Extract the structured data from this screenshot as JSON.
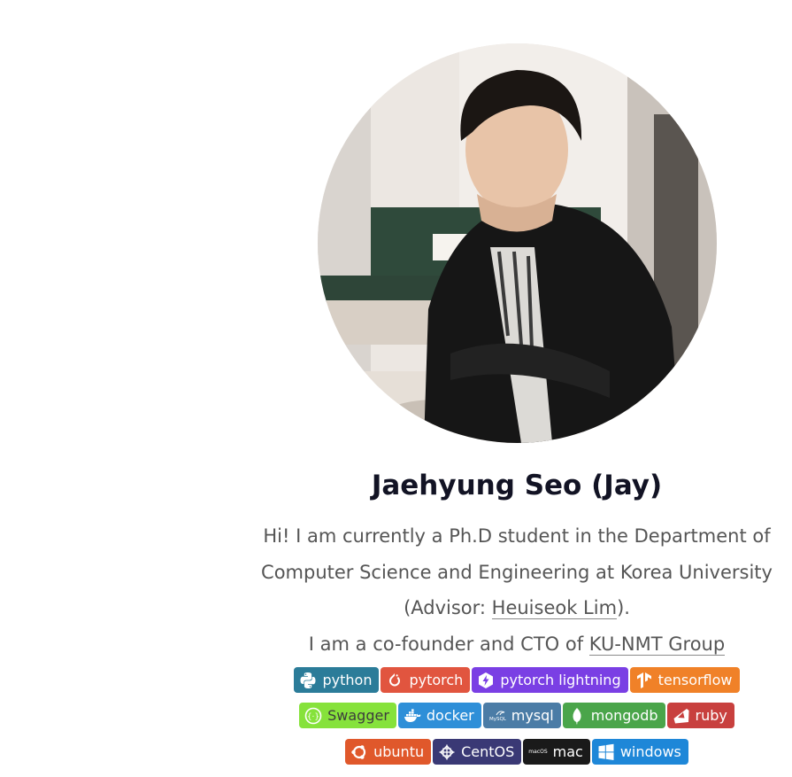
{
  "profile": {
    "avatar_alt": "profile photo",
    "name": "Jaehyung Seo (Jay)",
    "bio_line1": "Hi! I am currently a Ph.D student in the Department of",
    "bio_line2": "Computer Science and Engineering at Korea University",
    "bio_line3_prefix": "(Advisor: ",
    "advisor_link": "Heuiseok Lim",
    "bio_line3_suffix": ").",
    "bio_line4_prefix": "I am a co-founder and CTO of ",
    "group_link": "KU-NMT Group"
  },
  "badges": [
    {
      "label": "python",
      "icon": "python-icon",
      "color": "#2b7c99"
    },
    {
      "label": "pytorch",
      "icon": "pytorch-icon",
      "color": "#e1553f"
    },
    {
      "label": "pytorch lightning",
      "icon": "lightning-icon",
      "color": "#7a3fe4"
    },
    {
      "label": "tensorflow",
      "icon": "tensorflow-icon",
      "color": "#f08128"
    },
    {
      "label": "Swagger",
      "icon": "swagger-icon",
      "color": "#86e23b"
    },
    {
      "label": "docker",
      "icon": "docker-icon",
      "color": "#2e8fd8"
    },
    {
      "label": "mysql",
      "icon": "mysql-icon",
      "color": "#4b7ca6"
    },
    {
      "label": "mongodb",
      "icon": "mongodb-icon",
      "color": "#4aa54a"
    },
    {
      "label": "ruby",
      "icon": "ruby-icon",
      "color": "#c8403e"
    },
    {
      "label": "ubuntu",
      "icon": "ubuntu-icon",
      "color": "#e0582b"
    },
    {
      "label": "CentOS",
      "icon": "centos-icon",
      "color": "#3a3975"
    },
    {
      "label": "mac",
      "icon": "apple-icon",
      "icon_text": "macOS",
      "color": "#1a1a1a"
    },
    {
      "label": "windows",
      "icon": "windows-icon",
      "color": "#1e87d8"
    }
  ]
}
